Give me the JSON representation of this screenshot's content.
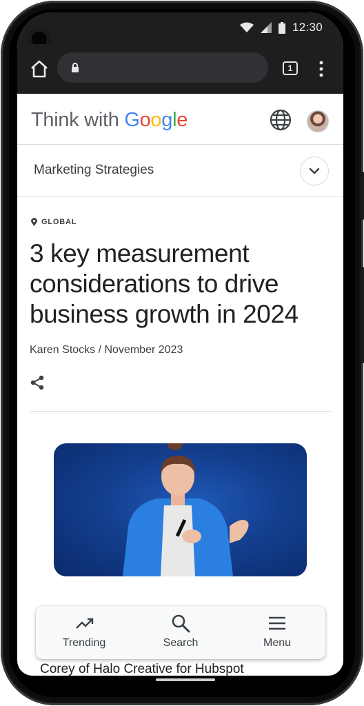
{
  "status_bar": {
    "time": "12:30"
  },
  "browser": {
    "tab_count": "1"
  },
  "site": {
    "brand_prefix": "Think with ",
    "brand_letters": [
      "G",
      "o",
      "o",
      "g",
      "l",
      "e"
    ]
  },
  "section": {
    "title": "Marketing Strategies"
  },
  "article": {
    "region": "GLOBAL",
    "headline": "3 key measurement considerations to drive business growth in 2024",
    "byline": "Karen Stocks / November 2023",
    "partial_text": "Corey of Halo Creative for Hubspot"
  },
  "bottom_nav": {
    "items": [
      {
        "label": "Trending",
        "icon": "trending-icon"
      },
      {
        "label": "Search",
        "icon": "search-icon"
      },
      {
        "label": "Menu",
        "icon": "menu-icon"
      }
    ]
  },
  "colors": {
    "google_blue": "#4285F4",
    "google_red": "#EA4335",
    "google_yellow": "#FBBC05",
    "google_green": "#34A853"
  }
}
